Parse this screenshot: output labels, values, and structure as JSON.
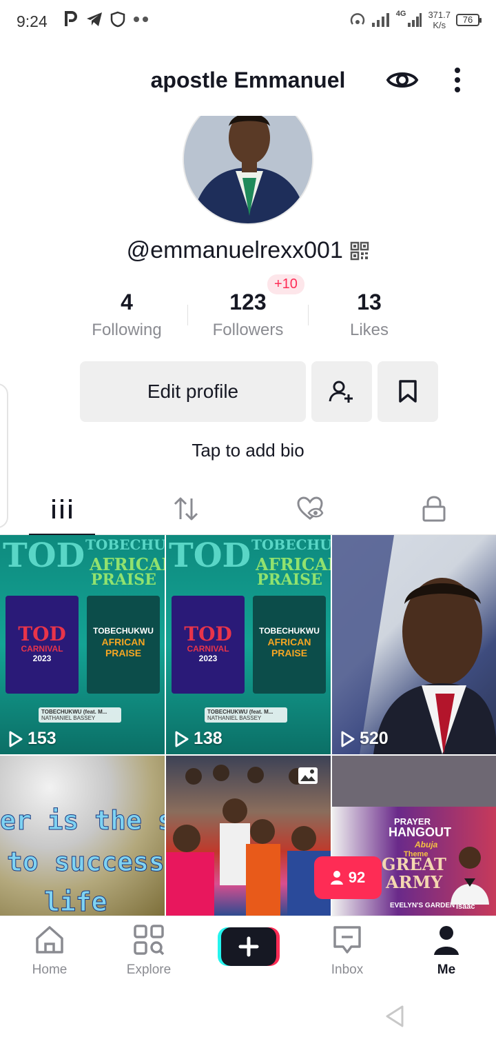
{
  "status_bar": {
    "time": "9:24",
    "network": "4G",
    "speed_value": "371.7",
    "speed_unit": "K/s",
    "battery": "76"
  },
  "header": {
    "name": "apostle Emmanuel"
  },
  "profile": {
    "handle": "@emmanuelrexx001",
    "new_followers_badge": "+10",
    "stats": [
      {
        "value": "4",
        "label": "Following"
      },
      {
        "value": "123",
        "label": "Followers"
      },
      {
        "value": "13",
        "label": "Likes"
      }
    ],
    "edit_button": "Edit profile",
    "bio_prompt": "Tap to add bio"
  },
  "tabs": [
    "videos-grid-icon",
    "reposts-icon",
    "liked-icon",
    "private-lock-icon"
  ],
  "videos": [
    {
      "views": "153"
    },
    {
      "views": "138"
    },
    {
      "views": "520"
    },
    {
      "views": ""
    },
    {
      "views": ""
    },
    {
      "views": ""
    }
  ],
  "poster": {
    "tod": "TOD",
    "carnival": "CARNIVAL",
    "year": "2023",
    "tobechukwu": "TOBECHUKWU",
    "african": "AFRICAN",
    "praise": "PRAISE",
    "song": "TOBECHUKWU (feat. M...",
    "artist": "NATHANIEL BASSEY"
  },
  "blur_text": {
    "line1": "er is the sh",
    "line2": "to success",
    "line3": "life"
  },
  "prayer_poster": {
    "prayer": "PRAYER",
    "hangout": "HANGOUT",
    "city": "Abuja",
    "theme": "Theme",
    "great": "GREAT",
    "army": "ARMY",
    "venue": "EVELYN'S GARDEN",
    "speaker": "Isaac"
  },
  "live_badge": "92",
  "bottom_nav": [
    {
      "label": "Home"
    },
    {
      "label": "Explore"
    },
    {
      "label": "Inbox"
    },
    {
      "label": "Me"
    }
  ],
  "colors": {
    "accent": "#fe2c55",
    "text": "#161823",
    "muted": "#8a8b91"
  }
}
